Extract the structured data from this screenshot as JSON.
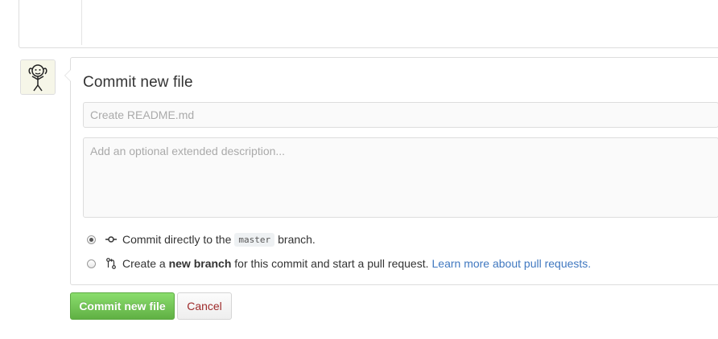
{
  "commit_form": {
    "title": "Commit new file",
    "summary_placeholder": "Create README.md",
    "description_placeholder": "Add an optional extended description...",
    "options": {
      "direct": {
        "text_before": "Commit directly to the",
        "branch": "master",
        "text_after": "branch.",
        "selected": true
      },
      "new_branch": {
        "text_before": "Create a",
        "bold": "new branch",
        "text_after": "for this commit and start a pull request.",
        "link": "Learn more about pull requests.",
        "selected": false
      }
    },
    "buttons": {
      "commit": "Commit new file",
      "cancel": "Cancel"
    }
  },
  "colors": {
    "primary_button": "#60b044",
    "cancel_text": "#9e2a2a",
    "link": "#4078c0"
  },
  "icons": {
    "commit": "git-commit-icon",
    "pull_request": "git-pull-request-icon"
  }
}
